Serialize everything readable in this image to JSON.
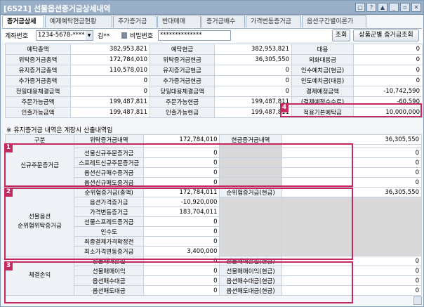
{
  "window": {
    "title": "[6521] 선물옵션증거금상세내역",
    "buttons": [
      "▢",
      "?",
      "▲",
      "_",
      "▫",
      "✕"
    ]
  },
  "tabs": [
    "증거금상세",
    "예제예탁현금현황",
    "추가증거금",
    "반대매매",
    "증거금배수",
    "가격변동증거금",
    "옵션구간별이론가"
  ],
  "account": {
    "label": "계좌번호",
    "number": "1234-5678-****",
    "name": "김**",
    "password_label": "비밀번호",
    "password_value": "**************",
    "search_btn": "조회",
    "product_btn": "상품군별 증거금조회"
  },
  "top_rows": [
    [
      "예탁총액",
      "382,953,821",
      "예탁현금",
      "382,953,821",
      "대용",
      "0"
    ],
    [
      "위탁증거금총액",
      "172,784,010",
      "위탁증거금현금",
      "36,305,550",
      "외화대용금",
      "0"
    ],
    [
      "유지증거금총액",
      "110,578,010",
      "유지증거금현금",
      "0",
      "인수예치금(현금)",
      "0"
    ],
    [
      "추가증거금총액",
      "0",
      "추가증거금현금",
      "0",
      "인도예치금(대용)",
      "0"
    ],
    [
      "전일대용체결금액",
      "0",
      "당일대용체결금액",
      "0",
      "결제예정금액",
      "-10,742,590"
    ],
    [
      "주문가능금액",
      "199,487,811",
      "주문가능현금",
      "199,487,811",
      "(결제예정수수료)",
      "-60,590"
    ],
    [
      "인출가능금액",
      "199,487,811",
      "인출가능현금",
      "199,487,811",
      "적용기본예탁금",
      "10,000,000"
    ]
  ],
  "note": "※ 유지증거금 내역은 계장시 산출내역임",
  "lower_header": {
    "c1": "구분",
    "c2": "위탁증거금내역",
    "c2_val": "172,784,010",
    "c3": "현금증거금내역",
    "c3_val": "36,305,550"
  },
  "section1": {
    "label": "신규주문증거금",
    "rows": [
      [
        "선물신규주문증거금",
        "0"
      ],
      [
        "스프레드신규주문증거금",
        "0"
      ],
      [
        "옵션신규매수증거금",
        "0"
      ],
      [
        "옵션신규매도증거금",
        "0"
      ]
    ],
    "cash": [
      "0",
      "0",
      "0",
      "0"
    ]
  },
  "section2": {
    "label1": "선물옵션",
    "label2": "순위험위탁증거금",
    "rows": [
      [
        "순위험증거금(총액)",
        "172,784,011"
      ],
      [
        "옵션가격증거금",
        "-10,920,000"
      ],
      [
        "가격변동증거금",
        "183,704,011"
      ],
      [
        "선물스프레드증거금",
        "0"
      ],
      [
        "인수도",
        "0"
      ],
      [
        "최종결제가격확정전",
        "0"
      ],
      [
        "최소가격변동증거금",
        "3,400,000"
      ]
    ],
    "cash_label": "순위험증거금(현금)",
    "cash_value": "36,305,550"
  },
  "section3": {
    "label": "체결손익",
    "rows": [
      [
        "선물매매손실",
        "0",
        "선물매매손실(현금)",
        "0"
      ],
      [
        "선물매매이익",
        "0",
        "선물매매이익(현금)",
        "0"
      ],
      [
        "옵션매수대금",
        "0",
        "옵션매수대금(현금)",
        "0"
      ],
      [
        "옵션매도대금",
        "0",
        "옵션매도대금(현금)",
        "0"
      ]
    ]
  },
  "badges": [
    "1",
    "2",
    "3",
    "4"
  ],
  "colors": {
    "highlight": "#c3285e",
    "header_bg": "#eef1f5",
    "title_bar": "#9ab0c8"
  }
}
